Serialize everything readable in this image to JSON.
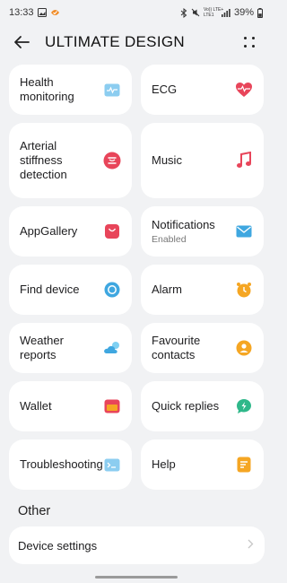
{
  "status": {
    "time": "13:33",
    "network": "Vo)) LTE+\nLTE1",
    "battery": "39%"
  },
  "header": {
    "title": "ULTIMATE DESIGN"
  },
  "cards": [
    {
      "label": "Health monitoring",
      "icon": "health-chart-icon"
    },
    {
      "label": "ECG",
      "icon": "heart-pulse-icon"
    },
    {
      "label": "Arterial stiffness detection",
      "icon": "arterial-icon"
    },
    {
      "label": "Music",
      "icon": "music-note-icon"
    },
    {
      "label": "AppGallery",
      "icon": "shopping-bag-icon"
    },
    {
      "label": "Notifications",
      "sub": "Enabled",
      "icon": "mail-icon"
    },
    {
      "label": "Find device",
      "icon": "find-device-icon"
    },
    {
      "label": "Alarm",
      "icon": "alarm-clock-icon"
    },
    {
      "label": "Weather reports",
      "icon": "weather-icon"
    },
    {
      "label": "Favourite contacts",
      "icon": "contact-icon"
    },
    {
      "label": "Wallet",
      "icon": "wallet-icon"
    },
    {
      "label": "Quick replies",
      "icon": "quick-reply-icon"
    },
    {
      "label": "Troubleshooting",
      "icon": "troubleshoot-icon"
    },
    {
      "label": "Help",
      "icon": "help-icon"
    }
  ],
  "other": {
    "section_title": "Other",
    "device_settings": "Device settings"
  },
  "colors": {
    "background": "#f1f2f4",
    "card": "#ffffff",
    "ecg": "#e8455a",
    "music": "#e8455a",
    "blue": "#3fa7e0",
    "orange": "#f5a623",
    "green": "#2fb88a"
  }
}
